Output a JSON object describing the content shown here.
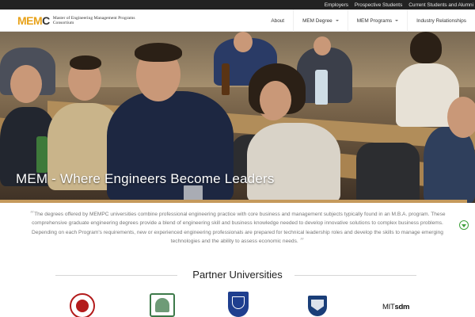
{
  "topbar": {
    "links": [
      "Employers",
      "Prospective Students",
      "Current Students and Alumni"
    ]
  },
  "header": {
    "logo": {
      "mark_main": "MEM",
      "mark_c": "C",
      "text": "Master of Engineering Management Programs Consortium"
    },
    "nav": [
      {
        "label": "About",
        "dropdown": false
      },
      {
        "label": "MEM Degree",
        "dropdown": true
      },
      {
        "label": "MEM Programs",
        "dropdown": true
      },
      {
        "label": "Industry Relationships",
        "dropdown": false
      }
    ]
  },
  "hero": {
    "title": "MEM - Where Engineers Become Leaders",
    "prev_glyph": "‹",
    "next_glyph": "›",
    "slides": 2,
    "active_slide": 1
  },
  "intro": {
    "open_quote": "“",
    "close_quote": "”",
    "text": "The degrees offered by MEMPC universities combine professional engineering practice with core business and management subjects typically found in an M.B.A. program. These comprehensive graduate engineering degrees provide a blend of engineering skill and business knowledge needed to develop innovative solutions to complex business problems. Depending on each Program's requirements, new or experienced engineering professionals are prepared for technical leadership roles and develop the skills to manage emerging technologies and the ability to assess economic needs."
  },
  "partners": {
    "title": "Partner Universities",
    "logos": [
      {
        "name": "cornell-seal",
        "text": ""
      },
      {
        "name": "dartmouth-seal",
        "text": ""
      },
      {
        "name": "duke-seal",
        "text": ""
      },
      {
        "name": "jhu-seal",
        "text": ""
      },
      {
        "name": "mit-sdm-logo",
        "text_a": "MIT",
        "text_b": "sdm"
      }
    ]
  },
  "colors": {
    "accent": "#e8a21a",
    "topbar": "#222222",
    "scroll_button": "#3fa13b"
  },
  "icons": [
    "caret-down-icon",
    "chevron-left-icon",
    "chevron-right-icon",
    "quote-icon",
    "scroll-down-icon"
  ]
}
